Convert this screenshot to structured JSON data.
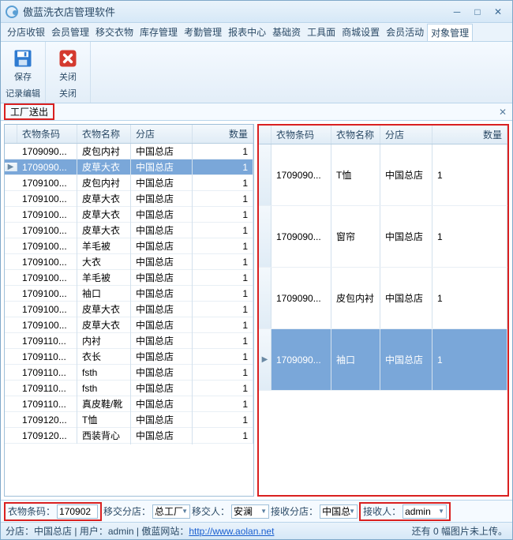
{
  "window": {
    "title": "傲蓝洗衣店管理软件"
  },
  "menu": [
    "分店收银",
    "会员管理",
    "移交衣物",
    "库存管理",
    "考勤管理",
    "报表中心",
    "基础资",
    "工具面",
    "商城设置",
    "会员活动",
    "对象管理"
  ],
  "menu_active_index": 10,
  "ribbon": {
    "group1": {
      "label": "记录编辑",
      "save": "保存"
    },
    "group2": {
      "label": "关闭",
      "close": "关闭"
    }
  },
  "page_label": "工厂送出",
  "left_grid": {
    "cols": [
      "衣物条码",
      "衣物名称",
      "分店",
      "数量"
    ],
    "rows": [
      {
        "code": "1709090...",
        "name": "皮包内衬",
        "shop": "中国总店",
        "qty": "1"
      },
      {
        "code": "1709090...",
        "name": "皮草大衣",
        "shop": "中国总店",
        "qty": "1",
        "selected": true
      },
      {
        "code": "1709100...",
        "name": "皮包内衬",
        "shop": "中国总店",
        "qty": "1"
      },
      {
        "code": "1709100...",
        "name": "皮草大衣",
        "shop": "中国总店",
        "qty": "1"
      },
      {
        "code": "1709100...",
        "name": "皮草大衣",
        "shop": "中国总店",
        "qty": "1"
      },
      {
        "code": "1709100...",
        "name": "皮草大衣",
        "shop": "中国总店",
        "qty": "1"
      },
      {
        "code": "1709100...",
        "name": "羊毛被",
        "shop": "中国总店",
        "qty": "1"
      },
      {
        "code": "1709100...",
        "name": "大衣",
        "shop": "中国总店",
        "qty": "1"
      },
      {
        "code": "1709100...",
        "name": "羊毛被",
        "shop": "中国总店",
        "qty": "1"
      },
      {
        "code": "1709100...",
        "name": "袖口",
        "shop": "中国总店",
        "qty": "1"
      },
      {
        "code": "1709100...",
        "name": "皮草大衣",
        "shop": "中国总店",
        "qty": "1"
      },
      {
        "code": "1709100...",
        "name": "皮草大衣",
        "shop": "中国总店",
        "qty": "1"
      },
      {
        "code": "1709110...",
        "name": "内衬",
        "shop": "中国总店",
        "qty": "1"
      },
      {
        "code": "1709110...",
        "name": "衣长",
        "shop": "中国总店",
        "qty": "1"
      },
      {
        "code": "1709110...",
        "name": "fsth",
        "shop": "中国总店",
        "qty": "1"
      },
      {
        "code": "1709110...",
        "name": "fsth",
        "shop": "中国总店",
        "qty": "1"
      },
      {
        "code": "1709110...",
        "name": "真皮鞋/靴",
        "shop": "中国总店",
        "qty": "1"
      },
      {
        "code": "1709120...",
        "name": "T恤",
        "shop": "中国总店",
        "qty": "1"
      },
      {
        "code": "1709120...",
        "name": "西装背心",
        "shop": "中国总店",
        "qty": "1"
      }
    ]
  },
  "right_grid": {
    "cols": [
      "衣物条码",
      "衣物名称",
      "分店",
      "数量"
    ],
    "rows": [
      {
        "code": "1709090...",
        "name": "T恤",
        "shop": "中国总店",
        "qty": "1"
      },
      {
        "code": "1709090...",
        "name": "窗帘",
        "shop": "中国总店",
        "qty": "1"
      },
      {
        "code": "1709090...",
        "name": "皮包内衬",
        "shop": "中国总店",
        "qty": "1"
      },
      {
        "code": "1709090...",
        "name": "袖口",
        "shop": "中国总店",
        "qty": "1",
        "selected": true
      }
    ]
  },
  "bottom": {
    "barcode_label": "衣物条码：",
    "barcode_value": "170902",
    "transfer_shop_label": "移交分店：",
    "transfer_shop_value": "总工厂",
    "transfer_person_label": "移交人：",
    "transfer_person_value": "安澜",
    "receive_shop_label": "接收分店：",
    "receive_shop_value": "中国总",
    "receiver_label": "接收人：",
    "receiver_value": "admin"
  },
  "status": {
    "shop_label": "分店：",
    "shop_value": "中国总店",
    "user_label": "用户：",
    "user_value": "admin",
    "site_label": "傲蓝网站：",
    "site_link": "http://www.aolan.net",
    "right_text": "还有 0 幅图片未上传。"
  }
}
